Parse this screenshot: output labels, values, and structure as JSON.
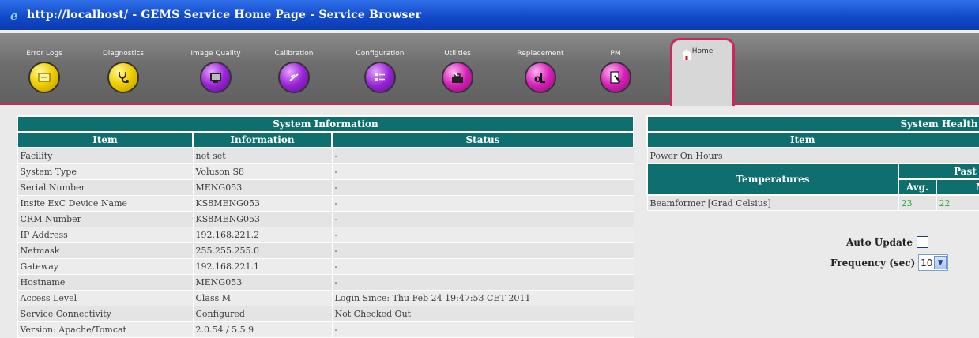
{
  "window": {
    "title": "http://localhost/ - GEMS Service Home Page - Service Browser"
  },
  "nav": {
    "items": [
      {
        "label": "Error Logs",
        "icon": "error-logs-icon",
        "color": "yellow"
      },
      {
        "label": "Diagnostics",
        "icon": "stethoscope-icon",
        "color": "yellow"
      },
      {
        "label": "Image Quality",
        "icon": "image-quality-icon",
        "color": "purple"
      },
      {
        "label": "Calibration",
        "icon": "calibration-icon",
        "color": "purple"
      },
      {
        "label": "Configuration",
        "icon": "configuration-icon",
        "color": "purple"
      },
      {
        "label": "Utilities",
        "icon": "utilities-icon",
        "color": "magenta"
      },
      {
        "label": "Replacement",
        "icon": "replacement-icon",
        "color": "magenta"
      },
      {
        "label": "PM",
        "icon": "pm-icon",
        "color": "magenta"
      }
    ],
    "home": {
      "label": "Home",
      "icon": "home-icon"
    }
  },
  "system_info": {
    "title": "System Information",
    "columns": [
      "Item",
      "Information",
      "Status"
    ],
    "rows": [
      {
        "item": "Facility",
        "info": "not set",
        "status": "-"
      },
      {
        "item": "System Type",
        "info": "Voluson S8",
        "status": "-"
      },
      {
        "item": "Serial Number",
        "info": "MENG053",
        "status": "-"
      },
      {
        "item": "Insite ExC Device Name",
        "info": "KS8MENG053",
        "status": "-"
      },
      {
        "item": "CRM Number",
        "info": "KS8MENG053",
        "status": "-"
      },
      {
        "item": "IP Address",
        "info": "192.168.221.2",
        "status": "-"
      },
      {
        "item": "Netmask",
        "info": "255.255.255.0",
        "status": "-"
      },
      {
        "item": "Gateway",
        "info": "192.168.221.1",
        "status": "-"
      },
      {
        "item": "Hostname",
        "info": "MENG053",
        "status": "-"
      },
      {
        "item": "Access Level",
        "info": "Class M",
        "status": "Login Since: Thu Feb 24 19:47:53 CET 2011"
      },
      {
        "item": "Service Connectivity",
        "info": "Configured",
        "status": "Not Checked Out"
      },
      {
        "item": "Version: Apache/Tomcat",
        "info": "2.0.54 / 5.5.9",
        "status": "-"
      }
    ]
  },
  "health": {
    "title": "System Health In",
    "item_header": "Item",
    "power_on_hours": "Power On Hours",
    "temperatures_header": "Temperatures",
    "past_header": "Past Fi",
    "avg_header": "Avg.",
    "min_header": "Mi",
    "row_label": "Beamformer [Grad Celsius]",
    "avg_value": "23",
    "min_value": "22"
  },
  "controls": {
    "auto_update_label": "Auto Update",
    "frequency_label": "Frequency (sec)",
    "frequency_value": "10"
  }
}
